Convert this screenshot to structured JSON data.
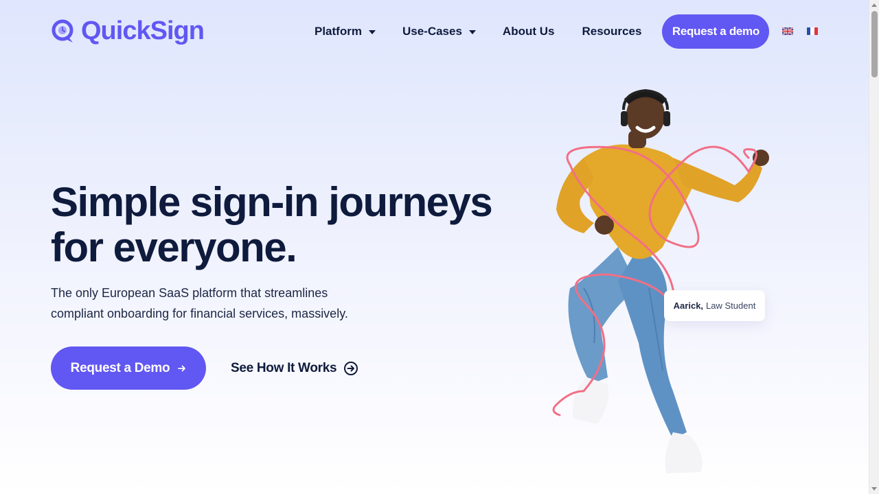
{
  "brand": {
    "name": "QuickSign",
    "accent": "#6157f2",
    "dark": "#0f1b3d"
  },
  "nav": {
    "items": [
      {
        "label": "Platform",
        "has_dropdown": true
      },
      {
        "label": "Use-Cases",
        "has_dropdown": true
      },
      {
        "label": "About Us",
        "has_dropdown": false
      },
      {
        "label": "Resources",
        "has_dropdown": false
      }
    ],
    "cta_label": "Request a demo",
    "languages": [
      "en-flag-icon",
      "fr-flag-icon"
    ]
  },
  "hero": {
    "title_line1": "Simple sign-in journeys",
    "title_line2": "for everyone.",
    "subtitle_line1": "The only European SaaS platform that streamlines",
    "subtitle_line2": "compliant onboarding for financial services, massively.",
    "primary_cta": "Request a Demo",
    "primary_cta_icon": "arrow-right-icon",
    "secondary_cta": "See How It Works",
    "secondary_cta_icon": "circle-arrow-right-icon"
  },
  "caption": {
    "name": "Aarick,",
    "role": "Law Student"
  }
}
